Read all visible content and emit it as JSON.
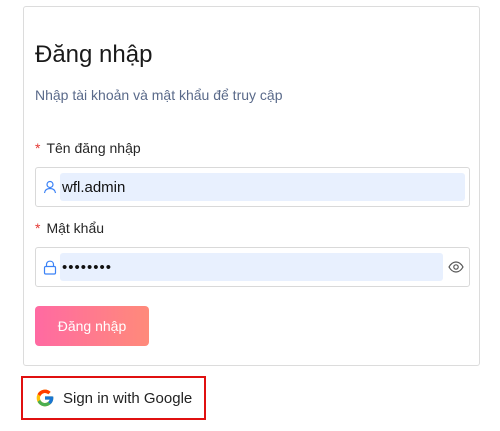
{
  "login": {
    "title": "Đăng nhập",
    "subtitle": "Nhập tài khoản và mật khẩu để truy cập",
    "username": {
      "required_mark": "*",
      "label": "Tên đăng nhập",
      "value": "wfl.admin"
    },
    "password": {
      "required_mark": "*",
      "label": "Mật khẩu",
      "value_masked": "••••••••"
    },
    "submit_label": "Đăng nhập"
  },
  "google": {
    "label": "Sign in with Google",
    "highlight_color": "#e01010"
  },
  "colors": {
    "button_gradient_start": "#ff6aa2",
    "button_gradient_end": "#ff8a7a",
    "autofill_bg": "#e8f0fe",
    "required": "#e53935"
  }
}
